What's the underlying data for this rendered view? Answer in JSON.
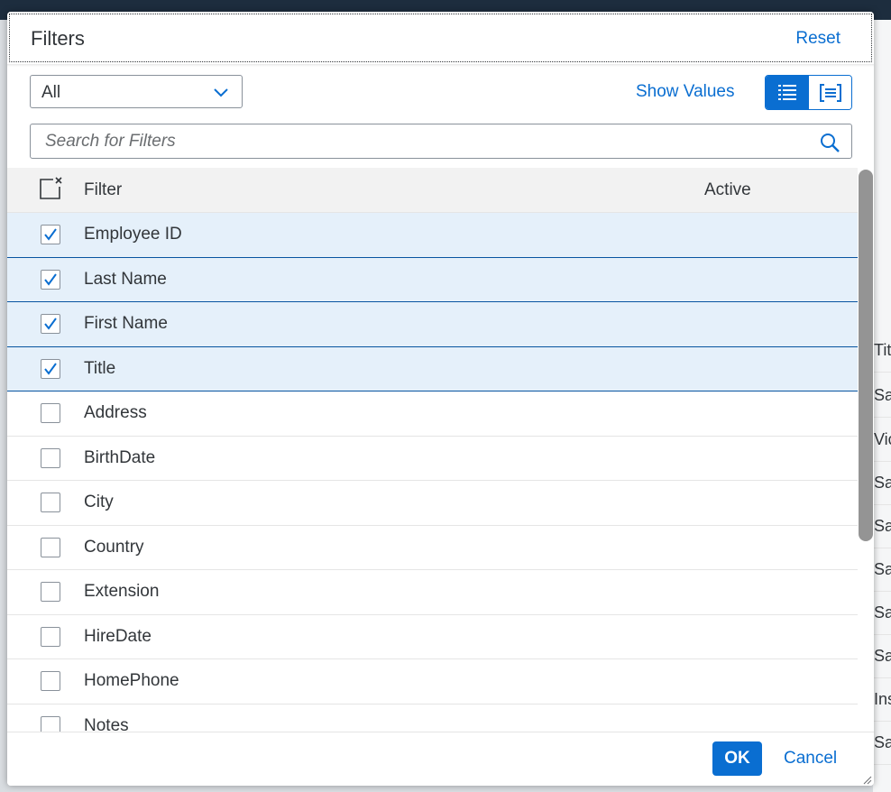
{
  "dialog": {
    "title": "Filters",
    "reset_label": "Reset"
  },
  "toolbar": {
    "selected_option": "All",
    "show_values_label": "Show Values",
    "view_buttons": [
      "list-view-icon",
      "grouped-view-icon"
    ]
  },
  "search": {
    "placeholder": "Search for Filters"
  },
  "table": {
    "columns": [
      "Filter",
      "Active"
    ],
    "rows": [
      {
        "label": "Employee ID",
        "checked": true
      },
      {
        "label": "Last Name",
        "checked": true
      },
      {
        "label": "First Name",
        "checked": true
      },
      {
        "label": "Title",
        "checked": true
      },
      {
        "label": "Address",
        "checked": false
      },
      {
        "label": "BirthDate",
        "checked": false
      },
      {
        "label": "City",
        "checked": false
      },
      {
        "label": "Country",
        "checked": false
      },
      {
        "label": "Extension",
        "checked": false
      },
      {
        "label": "HireDate",
        "checked": false
      },
      {
        "label": "HomePhone",
        "checked": false
      },
      {
        "label": "Notes",
        "checked": false
      }
    ]
  },
  "footer": {
    "ok_label": "OK",
    "cancel_label": "Cancel"
  },
  "background": {
    "cells": [
      "Tit",
      "Sa",
      "Vic",
      "Sa",
      "Sa",
      "Sa",
      "Sa",
      "Sa",
      "Ins",
      "Sa"
    ]
  },
  "colors": {
    "accent": "#0a6ed1",
    "selected_row": "#e5f0fa",
    "selected_border": "#0854a0",
    "text": "#32363a"
  }
}
